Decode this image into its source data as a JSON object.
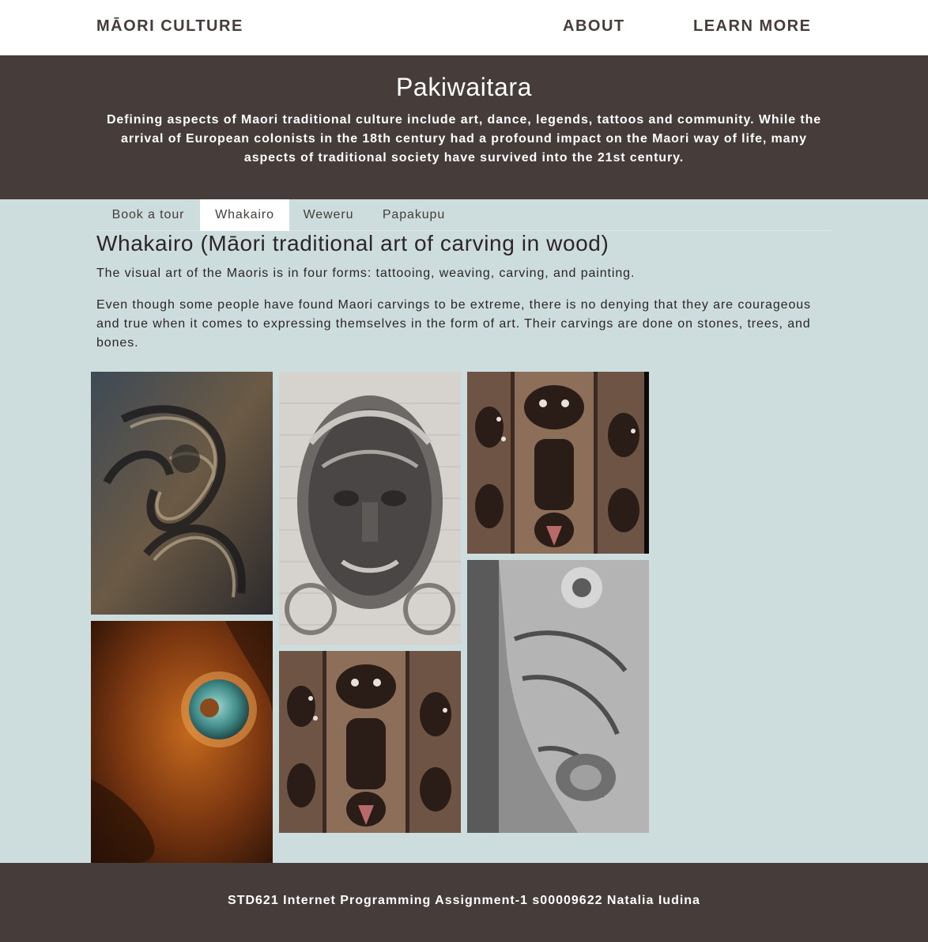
{
  "nav": {
    "brand": "MĀORI CULTURE",
    "links": [
      "ABOUT",
      "LEARN MORE"
    ]
  },
  "hero": {
    "title": "Pakiwaitara",
    "text": "Defining aspects of Maori traditional culture include art, dance, legends, tattoos and community. While the arrival of European colonists in the 18th century had a profound impact on the Maori way of life, many aspects of traditional society have survived into the 21st century."
  },
  "tabs": {
    "items": [
      "Book a tour",
      "Whakairo",
      "Weweru",
      "Papakupu"
    ],
    "active": "Whakairo"
  },
  "content": {
    "title": "Whakairo (Māori traditional art of carving in wood)",
    "paragraphs": [
      "The visual art of the Maoris is in four forms: tattooing, weaving, carving, and painting.",
      "Even though some people have found Maori carvings to be extreme, there is no denying that they are courageous and true when it comes to expressing themselves in the form of art. Their carvings are done on stones, trees, and bones."
    ]
  },
  "gallery": {
    "images": [
      "swirled-wood-carving-photo",
      "carved-wood-face-with-paua-eye-photo",
      "stone-carved-face-mask-photo",
      "carved-wooden-panels-photo",
      "carved-wooden-panels-photo",
      "grey-carved-post-detail-photo"
    ]
  },
  "footer": {
    "text": "STD621 Internet Programming Assignment-1 s00009622 Natalia Iudina"
  },
  "colors": {
    "dark": "#463c3a",
    "background": "#cddcdc",
    "white": "#ffffff"
  }
}
